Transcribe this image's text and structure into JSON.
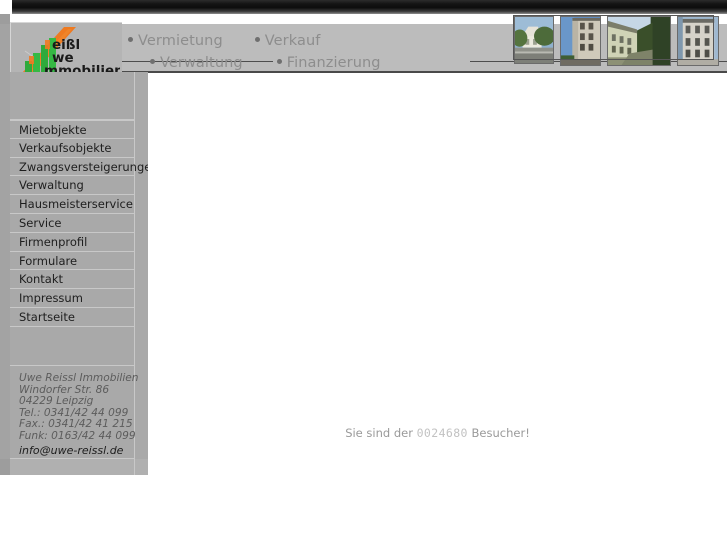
{
  "site": {
    "company": "Uwe Reissl Immobilien",
    "logo": {
      "name": "uwe-reissl-immobilien-logo",
      "line1": "eißl",
      "line2": "we",
      "line3": "mmobilien",
      "accent_orange": "#ee7a21",
      "accent_green": "#2faa3c"
    }
  },
  "top_nav": {
    "row1": [
      {
        "label": "Vermietung",
        "name": "nav-vermietung"
      },
      {
        "label": "Verkauf",
        "name": "nav-verkauf"
      }
    ],
    "row2": [
      {
        "label": "Verwaltung",
        "name": "nav-verwaltung"
      },
      {
        "label": "Finanzierung",
        "name": "nav-finanzierung"
      }
    ],
    "link_color": "#8d8d8d",
    "bullet_color": "#6f6f6f"
  },
  "photo_strip": {
    "name": "building-photo-strip",
    "photos": [
      {
        "alt": "Gebäude 1",
        "name": "building-photo-1",
        "sky": "#7fa8cf",
        "wall": "#e3e0d4",
        "roof": "#8d8f85",
        "foliage": "#4d6b3a",
        "ground": "#9a9a93"
      },
      {
        "alt": "Gebäude 2",
        "name": "building-photo-2",
        "sky": "#5f8ec4",
        "wall": "#cfc9ba",
        "roof": "#6d6a60",
        "foliage": "#3f5e33",
        "ground": "#6f6b62"
      },
      {
        "alt": "Gebäude 3",
        "name": "building-photo-3",
        "sky": "#b9cde0",
        "wall": "#cfd3b6",
        "roof": "#7b7d6a",
        "foliage": "#3a4f2a",
        "ground": "#8d9175"
      },
      {
        "alt": "Gebäude 4",
        "name": "building-photo-4",
        "sky": "#9fb8d0",
        "wall": "#d6d3ca",
        "roof": "#6a6a64",
        "foliage": "#4a5a40",
        "ground": "#b0ada4"
      }
    ]
  },
  "sidebar": {
    "items": [
      {
        "label": "Mietobjekte",
        "name": "sidebar-item-mietobjekte"
      },
      {
        "label": "Verkaufsobjekte",
        "name": "sidebar-item-verkaufsobjekte"
      },
      {
        "label": "Zwangsversteigerungen",
        "name": "sidebar-item-zwangsversteigerungen"
      },
      {
        "label": "Verwaltung",
        "name": "sidebar-item-verwaltung"
      },
      {
        "label": "Hausmeisterservice",
        "name": "sidebar-item-hausmeisterservice"
      },
      {
        "label": "Service",
        "name": "sidebar-item-service"
      },
      {
        "label": "Firmenprofil",
        "name": "sidebar-item-firmenprofil"
      },
      {
        "label": "Formulare",
        "name": "sidebar-item-formulare"
      },
      {
        "label": "Kontakt",
        "name": "sidebar-item-kontakt"
      },
      {
        "label": "Impressum",
        "name": "sidebar-item-impressum"
      },
      {
        "label": "Startseite",
        "name": "sidebar-item-startseite"
      }
    ]
  },
  "contact": {
    "name": "Uwe Reissl Immobilien",
    "street": "Windorfer Str. 86",
    "city": "04229 Leipzig",
    "tel": "Tel.:  0341/42 44 099",
    "fax": "Fax.:  0341/42 41 215",
    "mobile": "Funk: 0163/42 44 099",
    "email": "info@uwe-reissl.de"
  },
  "main": {
    "counter_prefix": "Sie sind der",
    "counter_value": "0024680",
    "counter_suffix": "Besucher!"
  },
  "colors": {
    "header_band": "#bcbcbc",
    "sidebar": "#a9a9a9",
    "divider": "#c8c8c8",
    "page_bg": "#ffffff",
    "text_dark": "#1e1e1e",
    "text_muted": "#5c5c5c"
  }
}
